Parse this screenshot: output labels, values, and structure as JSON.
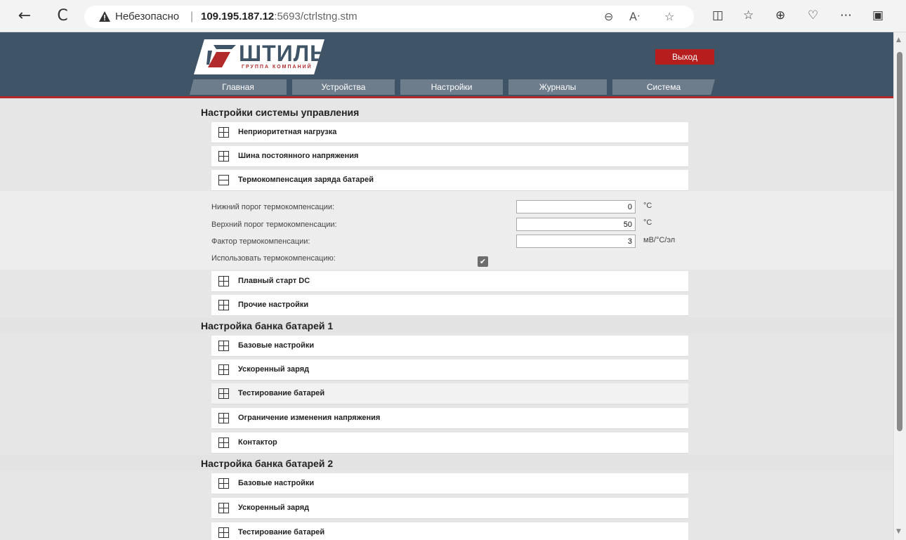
{
  "browser": {
    "back": "←",
    "reload": "C",
    "insecure_label": "Небезопасно",
    "url_host": "109.195.187.12",
    "url_port": ":5693",
    "url_path": "/ctrlstng.stm",
    "icons": [
      "zoom-out-icon",
      "read-aloud-icon",
      "favorite-star-icon",
      "split-screen-icon",
      "favorites-icon",
      "collections-icon",
      "performance-icon",
      "more-icon",
      "sidebar-icon"
    ]
  },
  "header": {
    "logo_text": "ШТИЛЬ",
    "logo_sub": "ГРУППА КОМПАНИЙ",
    "exit_label": "Выход",
    "tabs": [
      {
        "label": "Главная"
      },
      {
        "label": "Устройства"
      },
      {
        "label": "Настройки"
      },
      {
        "label": "Журналы"
      },
      {
        "label": "Система"
      }
    ]
  },
  "sections": [
    {
      "title": "Настройки системы управления",
      "items": [
        {
          "label": "Неприоритетная нагрузка",
          "expanded": false
        },
        {
          "label": "Шина постоянного напряжения",
          "expanded": false
        },
        {
          "label": "Термокомпенсация заряда батарей",
          "expanded": true
        },
        {
          "label": "Плавный старт DC",
          "expanded": false
        },
        {
          "label": "Прочие настройки",
          "expanded": false
        }
      ]
    },
    {
      "title": "Настройка банка батарей 1",
      "items": [
        {
          "label": "Базовые настройки"
        },
        {
          "label": "Ускоренный заряд"
        },
        {
          "label": "Тестирование батарей"
        },
        {
          "label": "Ограничение изменения напряжения"
        },
        {
          "label": "Контактор"
        }
      ]
    },
    {
      "title": "Настройка банка батарей 2",
      "items": [
        {
          "label": "Базовые настройки"
        },
        {
          "label": "Ускоренный заряд"
        },
        {
          "label": "Тестирование батарей"
        }
      ]
    }
  ],
  "thermo": {
    "fields": [
      {
        "label": "Нижний порог термокомпенсации:",
        "value": "0",
        "unit": "°C"
      },
      {
        "label": "Верхний порог термокомпенсации:",
        "value": "50",
        "unit": "°C"
      },
      {
        "label": "Фактор термокомпенсации:",
        "value": "3",
        "unit": "мВ/°C/эл"
      }
    ],
    "use_label": "Использовать термокомпенсацию:",
    "use_checked": true
  },
  "colors": {
    "header_bg": "#3f5466",
    "accent_red": "#b61e1e",
    "tab_bg": "#6d7d8c"
  }
}
